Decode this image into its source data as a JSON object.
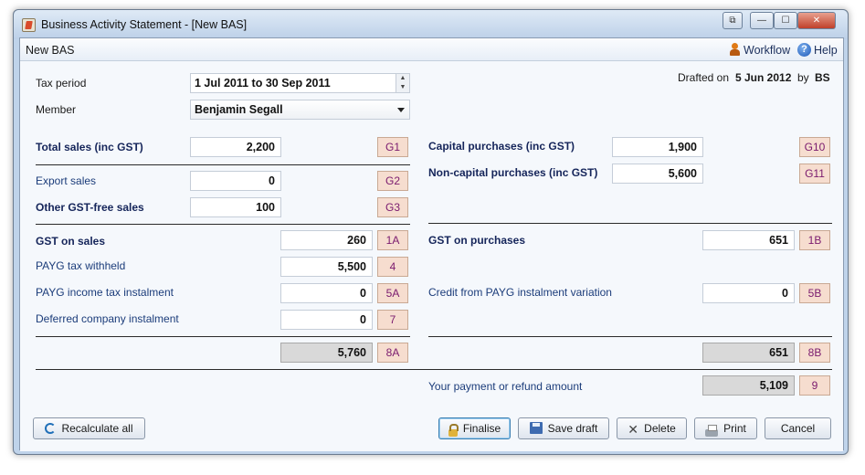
{
  "window": {
    "title": "Business Activity Statement - [New BAS]",
    "controls": {
      "restore": "⧉",
      "minimize": "—",
      "maximize": "☐",
      "close": "✕"
    }
  },
  "header": {
    "title": "New BAS",
    "workflow_label": "Workflow",
    "help_label": "Help",
    "icons": {
      "workflow": "workflow-person-icon",
      "help": "help-icon"
    }
  },
  "top": {
    "tax_period_label": "Tax period",
    "tax_period_value": "1 Jul 2011 to 30 Sep 2011",
    "member_label": "Member",
    "member_value": "Benjamin Segall",
    "drafted_on_label": "Drafted on",
    "drafted_on_value": "5 Jun 2012",
    "by_label": "by",
    "by_value": "BS"
  },
  "left": {
    "total_sales": {
      "label": "Total sales (inc GST)",
      "value": "2,200",
      "code": "G1"
    },
    "export_sales": {
      "label": "Export sales",
      "value": "0",
      "code": "G2"
    },
    "other_gst_free": {
      "label": "Other GST-free sales",
      "value": "100",
      "code": "G3"
    },
    "gst_on_sales": {
      "label": "GST on sales",
      "value": "260",
      "code": "1A"
    },
    "payg_withheld": {
      "label": "PAYG tax withheld",
      "value": "5,500",
      "code": "4"
    },
    "payg_instalment": {
      "label": "PAYG income tax instalment",
      "value": "0",
      "code": "5A"
    },
    "deferred_instalment": {
      "label": "Deferred company instalment",
      "value": "0",
      "code": "7"
    },
    "total": {
      "value": "5,760",
      "code": "8A"
    }
  },
  "right": {
    "capital_purchases": {
      "label": "Capital purchases (inc GST)",
      "value": "1,900",
      "code": "G10"
    },
    "non_capital_purchases": {
      "label": "Non-capital purchases (inc GST)",
      "value": "5,600",
      "code": "G11"
    },
    "gst_on_purchases": {
      "label": "GST on purchases",
      "value": "651",
      "code": "1B"
    },
    "credit_payg": {
      "label": "Credit from PAYG instalment variation",
      "value": "0",
      "code": "5B"
    },
    "total": {
      "value": "651",
      "code": "8B"
    },
    "payment": {
      "label": "Your payment or refund amount",
      "value": "5,109",
      "code": "9"
    }
  },
  "buttons": {
    "recalculate": "Recalculate all",
    "finalise": "Finalise",
    "save_draft": "Save draft",
    "delete": "Delete",
    "print": "Print",
    "cancel": "Cancel"
  },
  "colors": {
    "code_background": "#f6ddcf",
    "code_text": "#7a1a6e",
    "heading_text": "#15255a",
    "total_field": "#d9d9d9"
  }
}
